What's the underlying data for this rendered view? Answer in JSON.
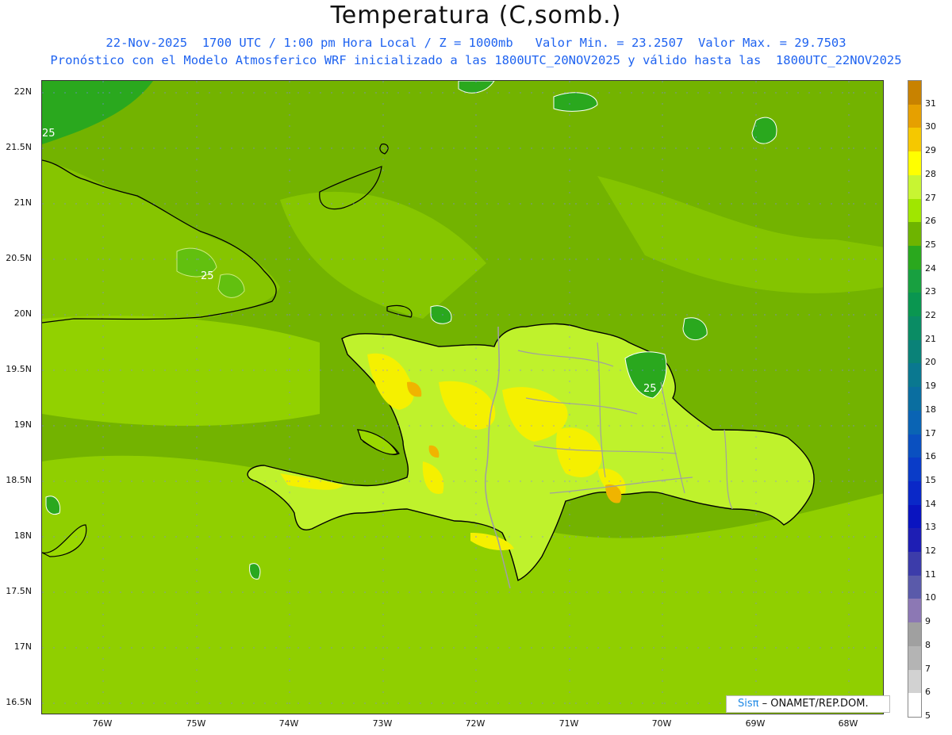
{
  "header": {
    "title": "Temperatura (C,somb.)",
    "line1": "22-Nov-2025  1700 UTC / 1:00 pm Hora Local / Z = 1000mb   Valor Min. = 23.2507  Valor Max. = 29.7503",
    "line2": "Pronóstico con el Modelo Atmosferico WRF inicializado a las 1800UTC_20NOV2025 y válido hasta las  1800UTC_22NOV2025"
  },
  "map": {
    "lat_labels": [
      "22N",
      "21.5N",
      "21N",
      "20.5N",
      "20N",
      "19.5N",
      "19N",
      "18.5N",
      "18N",
      "17.5N",
      "17N",
      "16.5N"
    ],
    "lon_labels": [
      "76W",
      "75W",
      "74W",
      "73W",
      "72W",
      "71W",
      "70W",
      "69W",
      "68W"
    ],
    "contour_labels": [
      "25",
      "25",
      "25"
    ],
    "colors": {
      "ocean": "#73b300",
      "land_light": "#bff22c",
      "land_yellow": "#f5f000",
      "land_orange": "#f0b400",
      "cool_patch": "#4ca200",
      "coastline": "#000000",
      "borders": "#a0a0a0"
    }
  },
  "legend": {
    "labels": [
      "31",
      "30",
      "29",
      "28",
      "27",
      "26",
      "25",
      "24",
      "23",
      "22",
      "21",
      "20",
      "19",
      "18",
      "17",
      "16",
      "15",
      "14",
      "13",
      "12",
      "11",
      "10",
      "9",
      "8",
      "7",
      "6",
      "5"
    ],
    "colors": [
      "#c88200",
      "#e6a000",
      "#f5c800",
      "#ffff00",
      "#c8f532",
      "#a0e600",
      "#6eb400",
      "#2aa81e",
      "#18a040",
      "#0a9650",
      "#0a8c64",
      "#0a8278",
      "#0a7890",
      "#0a6ea0",
      "#0a64b4",
      "#0a50c0",
      "#0a3cc8",
      "#0a28c8",
      "#0a14c0",
      "#1e1eb4",
      "#3c3caa",
      "#5a5aaa",
      "#8c78b4",
      "#a0a0a0",
      "#b4b4b4",
      "#d2d2d2",
      "#ffffff"
    ]
  },
  "credit": {
    "brand": "Sisπ",
    "text": "– ONAMET/REP.DOM."
  }
}
